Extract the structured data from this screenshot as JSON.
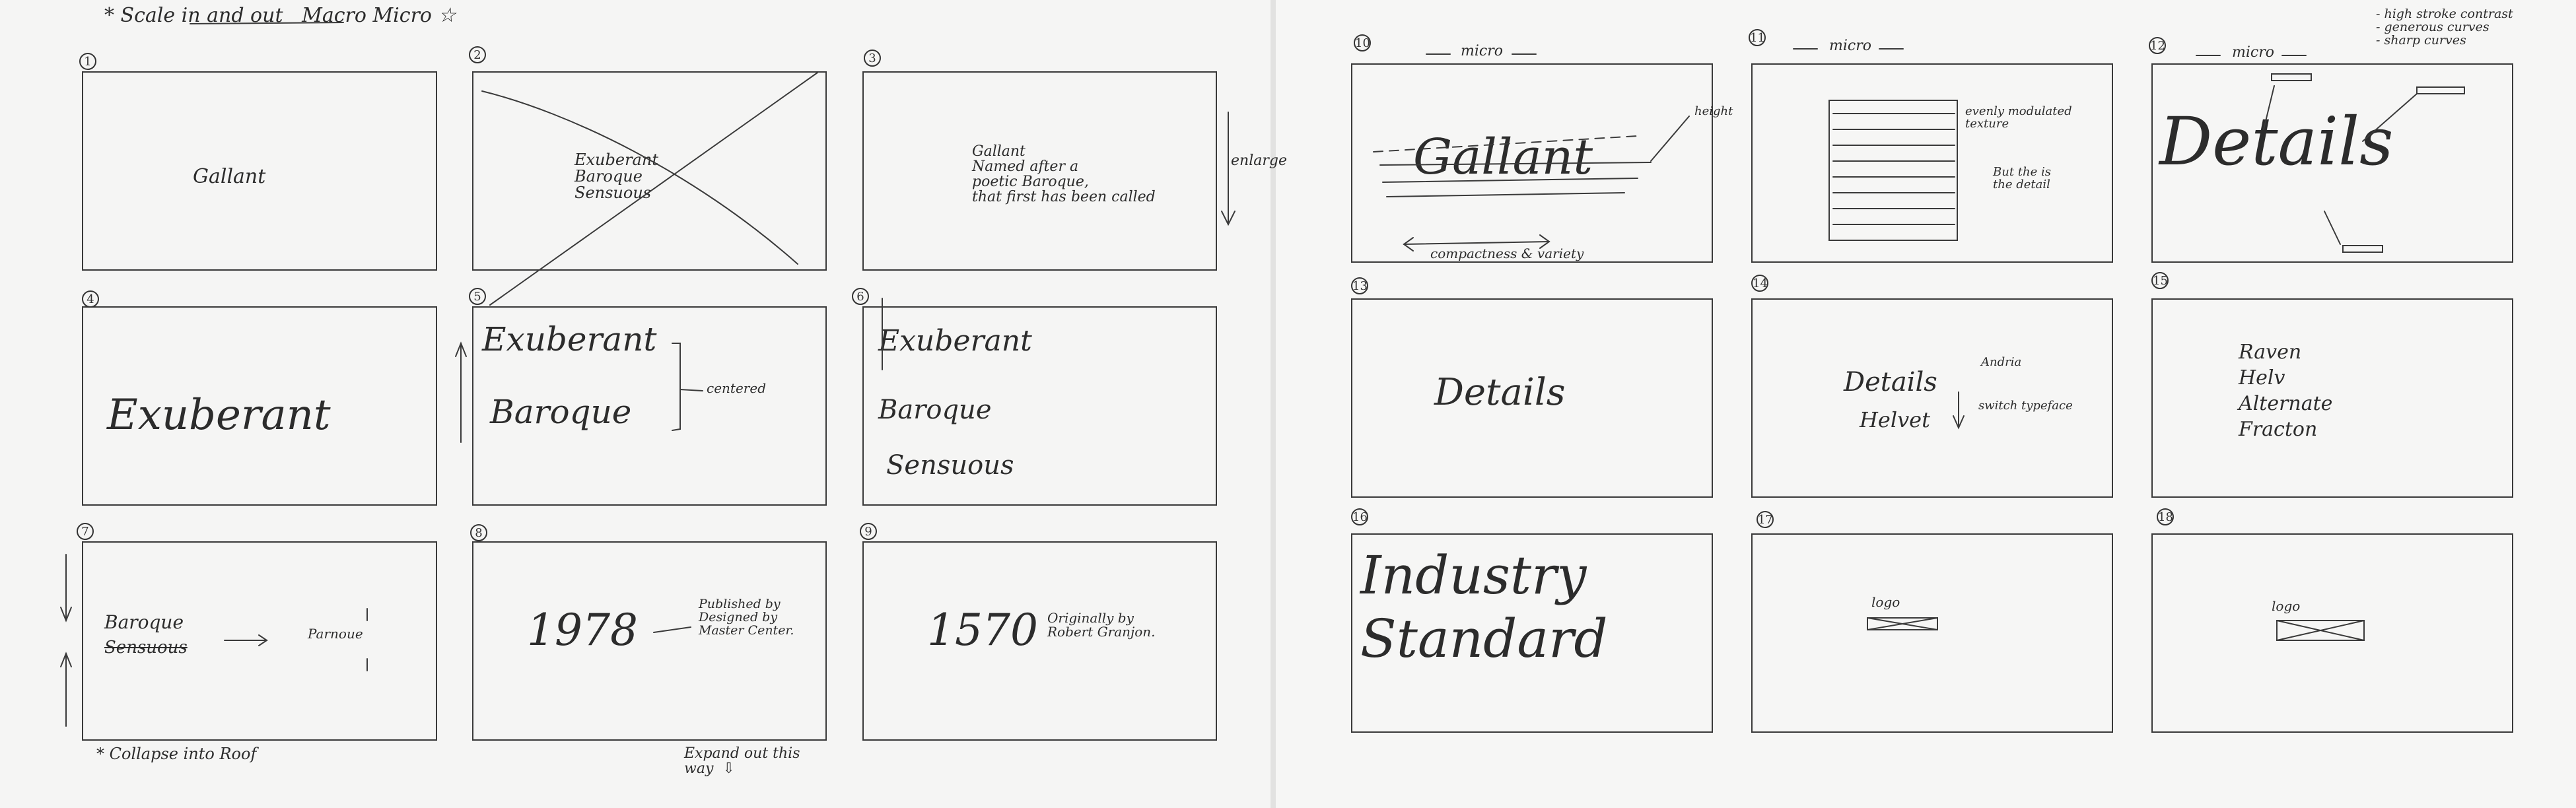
{
  "header": {
    "scale_note": "* Scale in and out   Macro Micro ☆"
  },
  "frames": [
    {
      "num": "1",
      "text": "Gallant"
    },
    {
      "num": "2",
      "text": "Exuberant\nBaroque\nSensuous"
    },
    {
      "num": "3",
      "text": "Gallant\nNamed after a\npoetic Baroque,\nthat first has been called",
      "side": "enlarge"
    },
    {
      "num": "4",
      "text": "Exuberant"
    },
    {
      "num": "5",
      "text_a": "Exuberant",
      "text_b": "Baroque",
      "side": "centered"
    },
    {
      "num": "6",
      "text_a": "Exuberant",
      "text_b": "Baroque",
      "text_c": "Sensuous"
    },
    {
      "num": "7",
      "text_a": "Baroque",
      "text_b": "Sensuous",
      "text_c": "Parnoue"
    },
    {
      "num": "8",
      "text_a": "1978",
      "text_b": "Published by\nDesigned by\nMaster Center."
    },
    {
      "num": "9",
      "text_a": "1570",
      "text_b": "Originally by\nRobert Granjon."
    },
    {
      "num": "10",
      "label": "micro",
      "text": "Gallant",
      "side": "height",
      "bottom": "compactness & variety"
    },
    {
      "num": "11",
      "label": "micro",
      "side_a": "evenly modulated\ntexture",
      "side_b": "But the is\nthe detail"
    },
    {
      "num": "12",
      "label": "micro",
      "text": "Details"
    },
    {
      "num": "13",
      "text": "Details"
    },
    {
      "num": "14",
      "text_a": "Details",
      "text_b": "Helvet",
      "side_a": "Andria",
      "side_b": "switch typeface"
    },
    {
      "num": "15",
      "text": "Raven\nHelv\nAlternate\nFracton"
    },
    {
      "num": "16",
      "text": "Industry\nStandard"
    },
    {
      "num": "17",
      "text": "logo"
    },
    {
      "num": "18",
      "text": "logo"
    }
  ],
  "notes": {
    "collapse": "* Collapse into Roof",
    "expand": "Expand out this\nway  ⇩",
    "top_right": "- high stroke contrast\n- generous curves\n- sharp curves"
  }
}
